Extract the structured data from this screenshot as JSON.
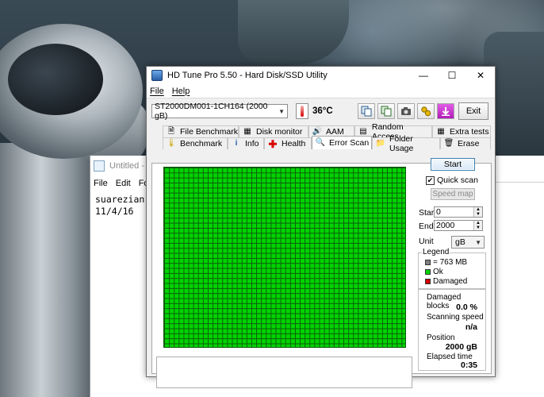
{
  "window": {
    "title": "HD Tune Pro 5.50 - Hard Disk/SSD Utility",
    "minimize_glyph": "—",
    "maximize_glyph": "☐",
    "close_glyph": "✕"
  },
  "menu": {
    "file": "File",
    "help": "Help"
  },
  "toolbar": {
    "drive": "ST2000DM001-1CH164 (2000 gB)",
    "temperature": "36°C",
    "exit_label": "Exit",
    "icons": [
      "copy-icon",
      "copy-info-icon",
      "screenshot-icon",
      "options-icon",
      "save-icon"
    ]
  },
  "tabs_top": [
    {
      "label": "File Benchmark",
      "icon": "file-benchmark-icon"
    },
    {
      "label": "Disk monitor",
      "icon": "disk-monitor-icon"
    },
    {
      "label": "AAM",
      "icon": "aam-icon"
    },
    {
      "label": "Random Access",
      "icon": "random-access-icon"
    },
    {
      "label": "Extra tests",
      "icon": "extra-tests-icon"
    }
  ],
  "tabs_bottom": [
    {
      "label": "Benchmark",
      "icon": "benchmark-icon"
    },
    {
      "label": "Info",
      "icon": "info-icon"
    },
    {
      "label": "Health",
      "icon": "health-icon"
    },
    {
      "label": "Error Scan",
      "icon": "error-scan-icon",
      "active": true
    },
    {
      "label": "Folder Usage",
      "icon": "folder-usage-icon"
    },
    {
      "label": "Erase",
      "icon": "erase-icon"
    }
  ],
  "controls": {
    "start_label": "Start",
    "quick_scan_label": "Quick scan",
    "quick_scan_checked": true,
    "speed_map_label": "Speed map",
    "start_field_label": "Start",
    "start_value": "0",
    "end_field_label": "End",
    "end_value": "2000",
    "unit_label": "Unit",
    "unit_value": "gB"
  },
  "legend": {
    "title": "Legend",
    "block_size": "= 763 MB",
    "ok": "Ok",
    "damaged": "Damaged",
    "colors": {
      "block": "#808080",
      "ok": "#00d400",
      "damaged": "#d40000"
    }
  },
  "stats": {
    "damaged_blocks_label": "Damaged blocks",
    "damaged_blocks_value": "0.0 %",
    "scanning_speed_label": "Scanning speed",
    "scanning_speed_value": "n/a",
    "position_label": "Position",
    "position_value": "2000 gB",
    "elapsed_label": "Elapsed time",
    "elapsed_value": "0:35"
  },
  "notepad": {
    "title": "Untitled - N",
    "menu": [
      "File",
      "Edit",
      "For"
    ],
    "text": "suarezian\n11/4/16"
  }
}
